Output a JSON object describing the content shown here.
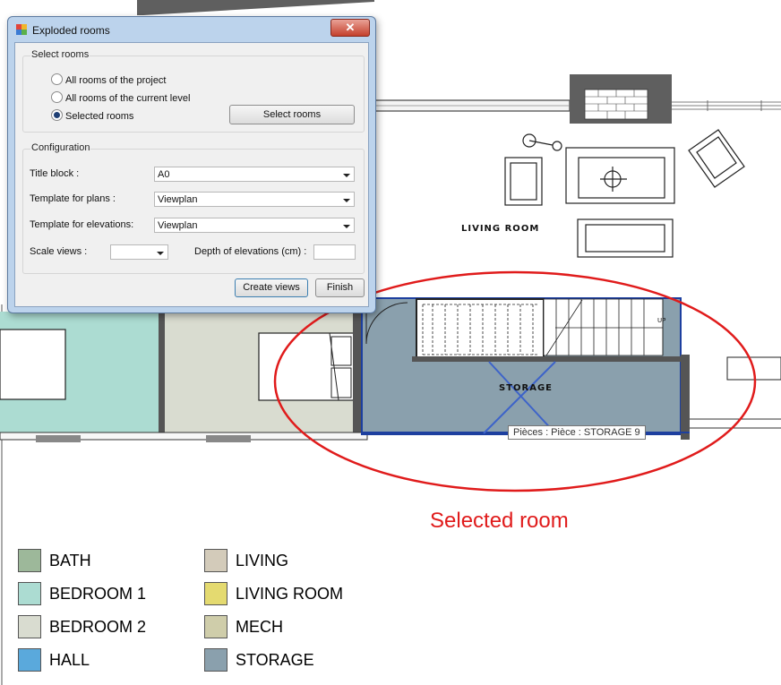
{
  "dialog": {
    "title": "Exploded rooms",
    "close_label": "✕",
    "select_group": {
      "title": "Select rooms",
      "options": [
        "All rooms of the project",
        "All rooms of the current level",
        "Selected rooms"
      ],
      "selected": "Selected rooms",
      "select_button": "Select rooms"
    },
    "config_group": {
      "title": "Configuration",
      "title_block_label": "Title block :",
      "title_block_value": "A0",
      "plans_label": "Template for plans :",
      "plans_value": "Viewplan",
      "elevations_label": "Template for elevations:",
      "elevations_value": "Viewplan",
      "scale_label": "Scale views :",
      "scale_value": "",
      "depth_label": "Depth of elevations (cm) :",
      "depth_value": ""
    },
    "create_button": "Create views",
    "finish_button": "Finish"
  },
  "plan": {
    "living_room_label": "LIVING ROOM",
    "storage_label": "STORAGE",
    "up_label": "UP",
    "tooltip": "Pièces : Pièce : STORAGE 9",
    "annotation": "Selected room"
  },
  "colors": {
    "bath": "#9db89a",
    "bedroom1": "#acdcd2",
    "bedroom2": "#d9dcd0",
    "hall": "#5aa9dc",
    "living": "#d3cbba",
    "living_room": "#e4da70",
    "mech": "#cfcdaa",
    "storage": "#8aa0ad",
    "annotation": "#e01b1b"
  },
  "legend": {
    "col1": [
      {
        "label": "BATH",
        "color": "#9db89a"
      },
      {
        "label": "BEDROOM 1",
        "color": "#acdcd2"
      },
      {
        "label": "BEDROOM 2",
        "color": "#d9dcd0"
      },
      {
        "label": "HALL",
        "color": "#5aa9dc"
      }
    ],
    "col2": [
      {
        "label": "LIVING",
        "color": "#d3cbba"
      },
      {
        "label": "LIVING ROOM",
        "color": "#e4da70"
      },
      {
        "label": "MECH",
        "color": "#cfcdaa"
      },
      {
        "label": "STORAGE",
        "color": "#8aa0ad"
      }
    ]
  }
}
